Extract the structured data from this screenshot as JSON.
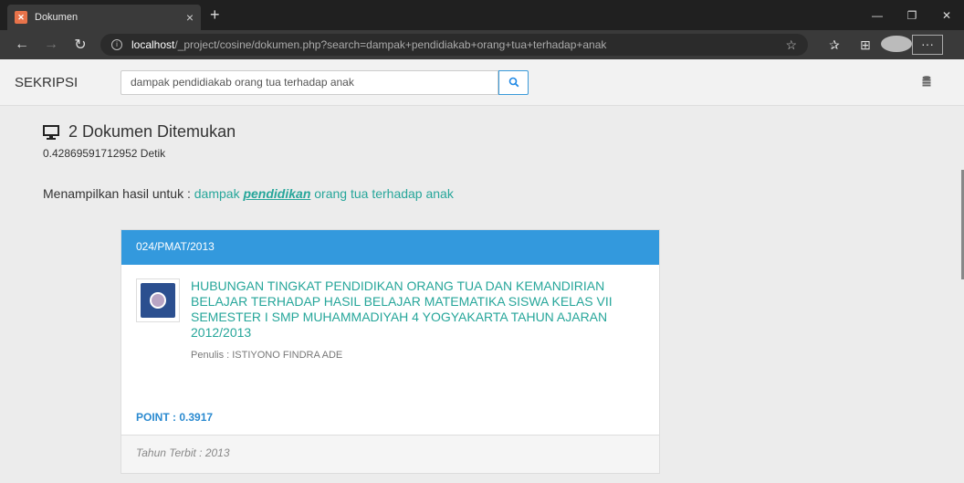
{
  "browser": {
    "tab_title": "Dokumen",
    "tab_close": "×",
    "new_tab": "+",
    "url_host": "localhost",
    "url_path": "/_project/cosine/dokumen.php?search=dampak+pendidiakab+orang+tua+terhadap+anak",
    "more": "···"
  },
  "navbar": {
    "brand": "SEKRIPSI",
    "search_value": "dampak pendidiakab orang tua terhadap anak"
  },
  "results": {
    "count_text": "2 Dokumen Ditemukan",
    "elapsed": "0.42869591712952 Detik",
    "showing_prefix": "Menampilkan hasil untuk :",
    "query_before": "dampak",
    "query_corrected": "pendidikan",
    "query_after": "orang tua terhadap anak"
  },
  "card": {
    "code": "024/PMAT/2013",
    "title": "HUBUNGAN TINGKAT PENDIDIKAN ORANG TUA DAN KEMANDIRIAN BELAJAR TERHADAP HASIL BELAJAR MATEMATIKA SISWA KELAS VII SEMESTER I SMP MUHAMMADIYAH 4 YOGYAKARTA TAHUN AJARAN 2012/2013",
    "author": "Penulis : ISTIYONO FINDRA ADE",
    "point": "POINT : 0.3917",
    "year": "Tahun Terbit : 2013"
  },
  "colors": {
    "accent_teal": "#26a69a",
    "header_blue": "#3399dd",
    "point_blue": "#2a8ad0"
  },
  "icons": [
    "back-icon",
    "forward-icon",
    "refresh-icon",
    "info-icon",
    "star-icon",
    "favorites-icon",
    "collections-icon",
    "profile-icon",
    "search-icon",
    "database-icon",
    "monitor-icon"
  ]
}
